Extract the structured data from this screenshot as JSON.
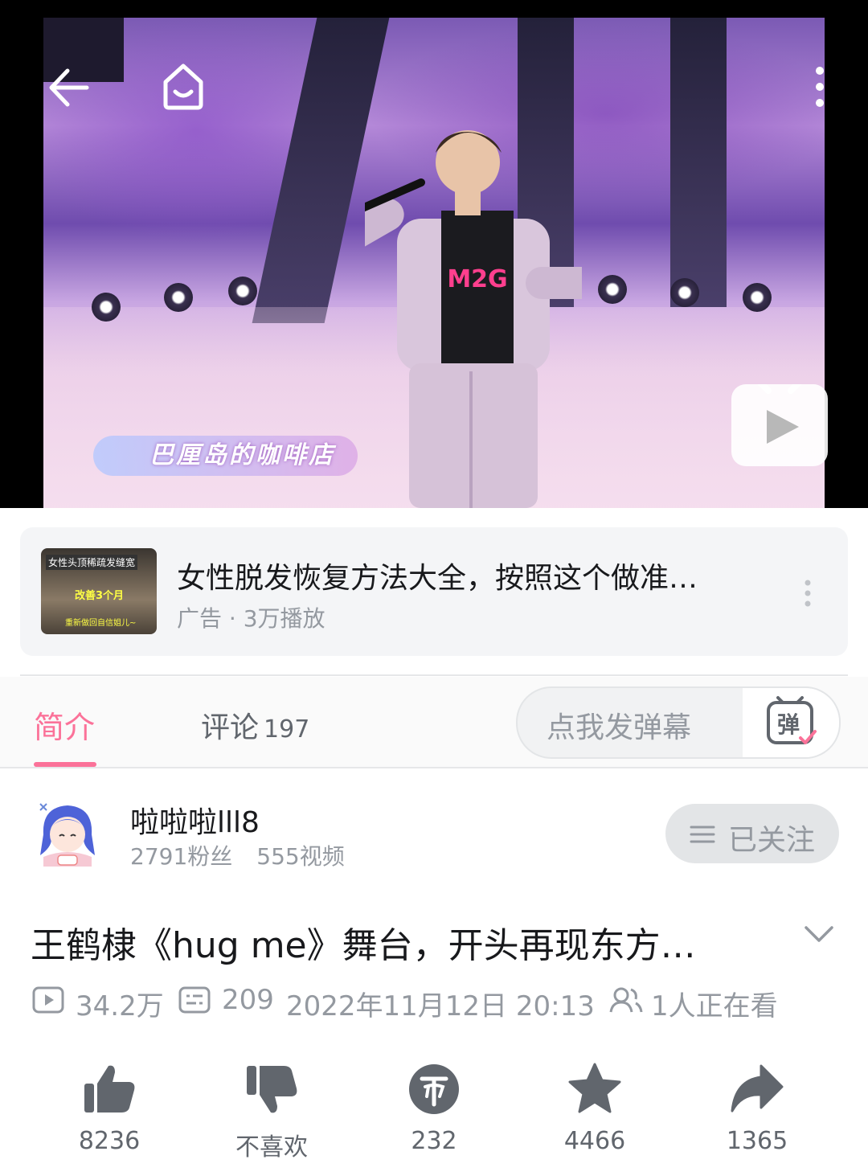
{
  "video": {
    "caption": "巴厘岛的咖啡店",
    "shirt_text": "M2G"
  },
  "ad": {
    "thumb_line1": "女性头顶稀疏发缝宽",
    "thumb_line2": "改善3个月",
    "thumb_line3": "重新做回自信姐儿~",
    "title": "女性脱发恢复方法大全，按照这个做准…",
    "subtitle": "广告 · 3万播放"
  },
  "tabs": {
    "intro": "简介",
    "comments": "评论",
    "comments_count": "197",
    "danmaku_placeholder": "点我发弹幕",
    "danmaku_icon_label": "弹"
  },
  "uploader": {
    "name": "啦啦啦lll8",
    "fans": "2791粉丝",
    "videos": "555视频",
    "follow_label": "已关注"
  },
  "video_info": {
    "title": "王鹤棣《hug me》舞台，开头再现东方…",
    "views": "34.2万",
    "danmaku_count": "209",
    "datetime": "2022年11月12日 20:13",
    "watching": "1人正在看"
  },
  "actions": {
    "like": "8236",
    "dislike": "不喜欢",
    "coin": "232",
    "favorite": "4466",
    "share": "1365"
  },
  "colors": {
    "accent": "#fb7299",
    "text_secondary": "#9499a0",
    "icon_gray": "#61666d"
  }
}
